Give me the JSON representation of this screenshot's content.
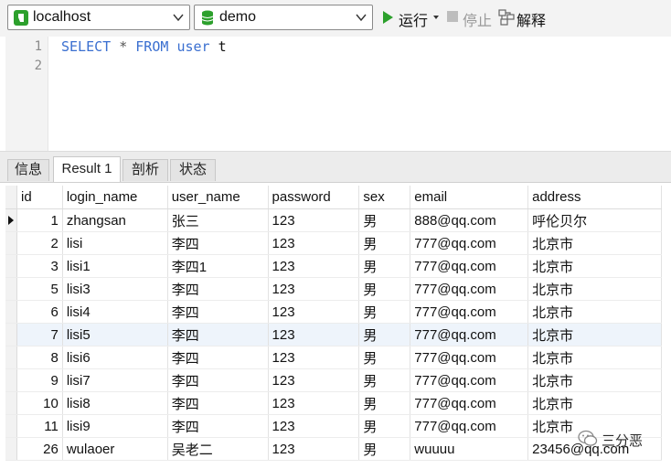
{
  "toolbar": {
    "connection": "localhost",
    "database": "demo",
    "run_label": "运行",
    "stop_label": "停止",
    "explain_label": "解释"
  },
  "editor": {
    "lines": [
      "1",
      "2"
    ],
    "tokens": [
      "SELECT",
      "*",
      "FROM",
      "user",
      "t"
    ]
  },
  "tabs": [
    "信息",
    "Result 1",
    "剖析",
    "状态"
  ],
  "active_tab": "Result 1",
  "grid": {
    "columns": [
      "id",
      "login_name",
      "user_name",
      "password",
      "sex",
      "email",
      "address"
    ],
    "rows": [
      [
        "1",
        "zhangsan",
        "张三",
        "123",
        "男",
        "888@qq.com",
        "呼伦贝尔"
      ],
      [
        "2",
        "lisi",
        "李四",
        "123",
        "男",
        "777@qq.com",
        "北京市"
      ],
      [
        "3",
        "lisi1",
        "李四1",
        "123",
        "男",
        "777@qq.com",
        "北京市"
      ],
      [
        "5",
        "lisi3",
        "李四",
        "123",
        "男",
        "777@qq.com",
        "北京市"
      ],
      [
        "6",
        "lisi4",
        "李四",
        "123",
        "男",
        "777@qq.com",
        "北京市"
      ],
      [
        "7",
        "lisi5",
        "李四",
        "123",
        "男",
        "777@qq.com",
        "北京市"
      ],
      [
        "8",
        "lisi6",
        "李四",
        "123",
        "男",
        "777@qq.com",
        "北京市"
      ],
      [
        "9",
        "lisi7",
        "李四",
        "123",
        "男",
        "777@qq.com",
        "北京市"
      ],
      [
        "10",
        "lisi8",
        "李四",
        "123",
        "男",
        "777@qq.com",
        "北京市"
      ],
      [
        "11",
        "lisi9",
        "李四",
        "123",
        "男",
        "777@qq.com",
        "北京市"
      ],
      [
        "26",
        "wulaoer",
        "吴老二",
        "123",
        "男",
        "wuuuu",
        "23456@qq.com"
      ]
    ]
  },
  "watermark": "三分恶",
  "colors": {
    "keyword": "#3a6fd0",
    "run_icon": "#2ca02c",
    "db_icon": "#2ca02c",
    "highlight_row": "#eef4fb"
  },
  "icons": [
    "connection-icon",
    "database-icon",
    "chevron-down-icon",
    "play-icon",
    "stop-icon",
    "explain-icon",
    "row-pointer-icon",
    "wechat-icon"
  ]
}
